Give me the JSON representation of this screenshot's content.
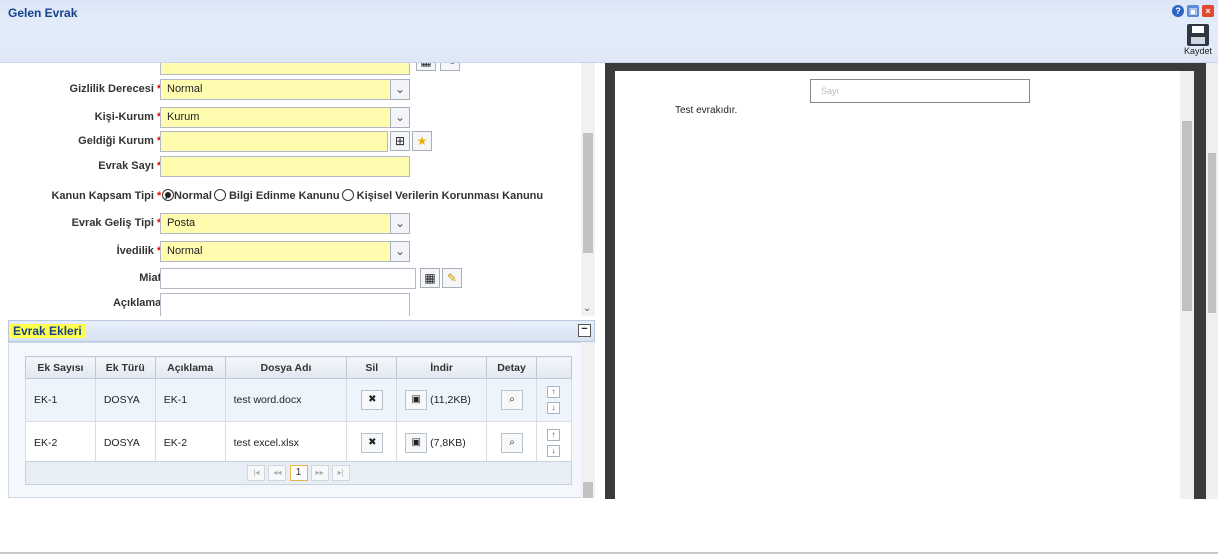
{
  "window": {
    "title": "Gelen Evrak",
    "save_label": "Kaydet"
  },
  "form": {
    "rows": [
      {
        "label": "Gizlilik Derecesi",
        "value": "Normal"
      },
      {
        "label": "Kişi-Kurum",
        "value": "Kurum"
      },
      {
        "label": "Geldiği Kurum",
        "value": ""
      },
      {
        "label": "Evrak Sayı",
        "value": ""
      },
      {
        "label": "Kanun Kapsam Tipi"
      },
      {
        "label": "Evrak Geliş Tipi",
        "value": "Posta"
      },
      {
        "label": "İvedilik",
        "value": "Normal"
      },
      {
        "label": "Miat",
        "value": ""
      },
      {
        "label": "Açıklama",
        "value": ""
      }
    ],
    "radio_options": [
      "Normal",
      "Bilgi Edinme Kanunu",
      "Kişisel Verilerin Korunması Kanunu"
    ],
    "required_mark": "*",
    "colon": ":"
  },
  "attachments": {
    "title": "Evrak Ekleri",
    "columns": [
      "Ek Sayısı",
      "Ek Türü",
      "Açıklama",
      "Dosya Adı",
      "Sil",
      "İndir",
      "Detay"
    ],
    "rows": [
      {
        "ek_sayisi": "EK-1",
        "ek_turu": "DOSYA",
        "aciklama": "EK-1",
        "dosya_adi": "test word.docx",
        "size": "(11,2KB)"
      },
      {
        "ek_sayisi": "EK-2",
        "ek_turu": "DOSYA",
        "aciklama": "EK-2",
        "dosya_adi": "test excel.xlsx",
        "size": "(7,8KB)"
      }
    ],
    "page": "1"
  },
  "preview": {
    "field_placeholder": "Sayı",
    "body_text": "Test evrakıdır."
  },
  "colors": {
    "accent": "#15428b",
    "required_field": "#fffcb0",
    "highlight": "#ffff50"
  }
}
